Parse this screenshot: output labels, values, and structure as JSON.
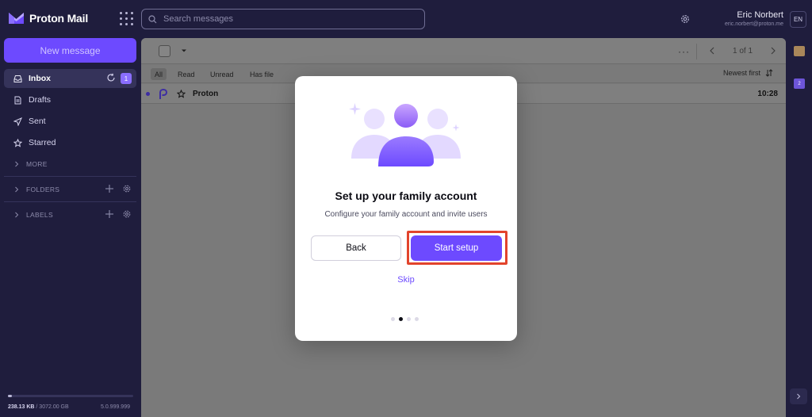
{
  "app": {
    "name": "Proton Mail"
  },
  "search": {
    "placeholder": "Search messages"
  },
  "user": {
    "name": "Eric Norbert",
    "email": "eric.norbert@proton.me",
    "language": "EN"
  },
  "sidebar": {
    "new_message": "New message",
    "items": [
      {
        "label": "Inbox",
        "badge": "1",
        "active": true
      },
      {
        "label": "Drafts"
      },
      {
        "label": "Sent"
      },
      {
        "label": "Starred"
      }
    ],
    "more": "MORE",
    "folders": "FOLDERS",
    "labels": "LABELS",
    "storage": {
      "used": "238.13 KB",
      "total": "/ 3072.00 GB",
      "fraction": 0.03
    },
    "version": "5.0.999.999"
  },
  "toolbar": {
    "pager": "1 of 1",
    "more": "···"
  },
  "filters": {
    "all": "All",
    "read": "Read",
    "unread": "Unread",
    "has_file": "Has file",
    "sort": "Newest first"
  },
  "messages": [
    {
      "sender": "Proton",
      "time": "10:28",
      "unread": true
    }
  ],
  "rail": {
    "calendar_day": "2"
  },
  "modal": {
    "title": "Set up your family account",
    "description": "Configure your family account and invite users",
    "back": "Back",
    "start": "Start setup",
    "skip": "Skip",
    "steps": 4,
    "current_step": 2
  },
  "colors": {
    "brand": "#6d4aff",
    "highlight": "#e2442c",
    "background": "#1f1d3d"
  }
}
